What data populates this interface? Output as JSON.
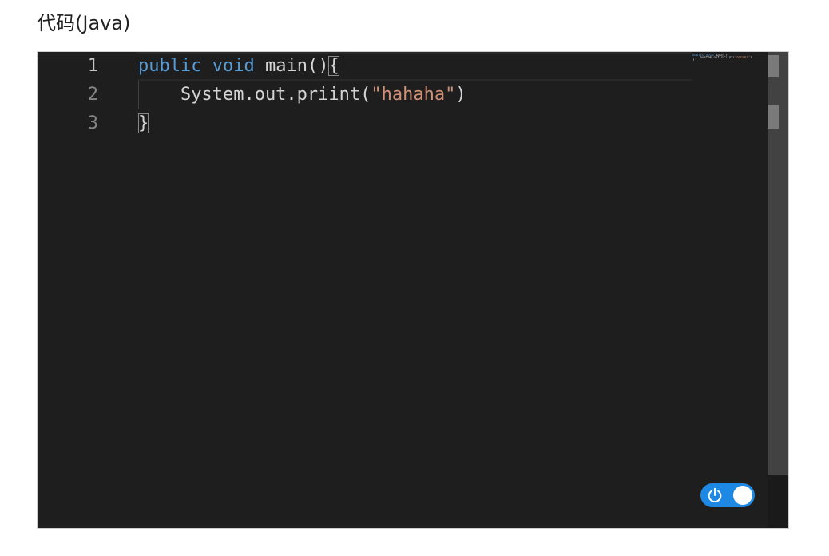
{
  "page": {
    "section_title": "代码(Java)"
  },
  "editor": {
    "language": "Java",
    "line_numbers": [
      "1",
      "2",
      "3"
    ],
    "active_line": "1",
    "lines": [
      [
        {
          "type": "kw",
          "text": "public"
        },
        {
          "type": "plain",
          "text": " "
        },
        {
          "type": "kw",
          "text": "void"
        },
        {
          "type": "plain",
          "text": " main()"
        },
        {
          "type": "bracket",
          "text": "{"
        }
      ],
      [
        {
          "type": "plain",
          "text": "    System.out.priint("
        },
        {
          "type": "str",
          "text": "\"hahaha\""
        },
        {
          "type": "plain",
          "text": ")"
        }
      ],
      [
        {
          "type": "bracket",
          "text": "}"
        }
      ]
    ],
    "colors": {
      "background": "#1e1e1e",
      "keyword": "#569cd6",
      "string": "#ce9178",
      "text": "#d4d4d4",
      "line_number": "#858585"
    }
  },
  "toggle": {
    "icon": "power-icon",
    "state": "on",
    "color": "#1e88e5"
  }
}
